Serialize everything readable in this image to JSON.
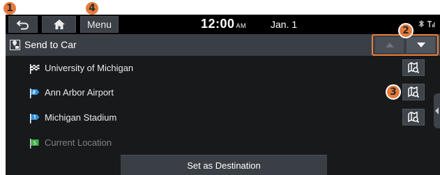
{
  "callouts": [
    "1",
    "4",
    "2",
    "3"
  ],
  "topbar": {
    "menu_label": "Menu",
    "time": "12:00",
    "ampm": "AM",
    "date": "Jan. 1"
  },
  "header": {
    "title": "Send to Car"
  },
  "list": {
    "items": [
      {
        "label": "University of Michigan",
        "icon": "checkered-flag-icon",
        "dimmed": false
      },
      {
        "label": "Ann Arbor Airport",
        "icon": "waypoint-2-flag-icon",
        "dimmed": false
      },
      {
        "label": "Michigan Stadium",
        "icon": "waypoint-1-flag-icon",
        "dimmed": false
      },
      {
        "label": "Current Location",
        "icon": "start-flag-icon",
        "dimmed": true
      }
    ]
  },
  "actions": {
    "set_destination_label": "Set as Destination"
  },
  "colors": {
    "callout": "#e57a3c",
    "background": "#18191b",
    "bar": "#3a3f46",
    "waypoint_blue": "#2f8fd8",
    "start_green": "#3fae49"
  }
}
